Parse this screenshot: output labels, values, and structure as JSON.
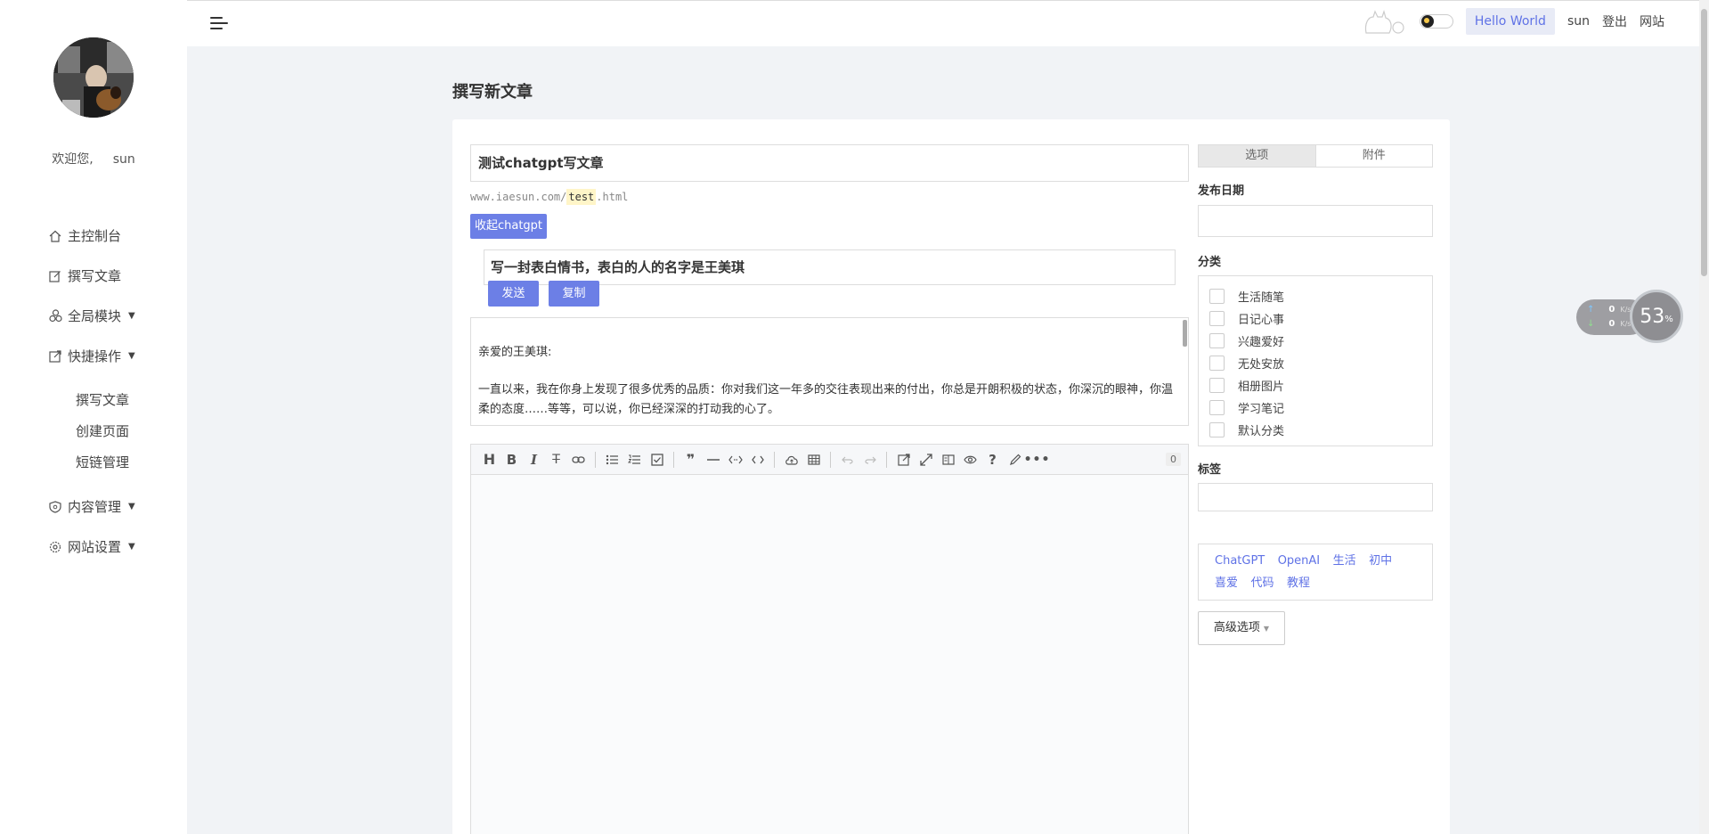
{
  "sidebar": {
    "welcome_prefix": "欢迎您,",
    "username": "sun",
    "items": [
      {
        "label": "主控制台",
        "icon": "home-icon"
      },
      {
        "label": "撰写文章",
        "icon": "edit-icon"
      },
      {
        "label": "全局模块",
        "icon": "modules-icon"
      },
      {
        "label": "快捷操作",
        "icon": "shortcut-icon"
      },
      {
        "label": "内容管理",
        "icon": "content-icon"
      },
      {
        "label": "网站设置",
        "icon": "settings-icon"
      }
    ],
    "subitems": [
      {
        "label": "撰写文章"
      },
      {
        "label": "创建页面"
      },
      {
        "label": "短链管理"
      }
    ]
  },
  "topbar": {
    "hello": "Hello World",
    "user": "sun",
    "logout": "登出",
    "site": "网站"
  },
  "page": {
    "title": "撰写新文章"
  },
  "editor": {
    "post_title": "测试chatgpt写文章",
    "slug_prefix": "www.iaesun.com/",
    "slug": "test",
    "slug_suffix": ".html",
    "collapse_chatgpt": "收起chatgpt",
    "prompt": "写一封表白情书，表白的人的名字是王美琪",
    "send": "发送",
    "copy": "复制",
    "answer_lines": [
      "亲爱的王美琪:",
      "一直以来，我在你身上发现了很多优秀的品质：你对我们这一年多的交往表现出来的付出，你总是开朗积极的状态，你深沉的眼神，你温柔的态度……等等，可以说，你已经深深的打动我的心了。"
    ],
    "word_count": "0"
  },
  "side": {
    "tab_options": "选项",
    "tab_attachments": "附件",
    "publish_date_label": "发布日期",
    "category_label": "分类",
    "categories": [
      "生活随笔",
      "日记心事",
      "兴趣爱好",
      "无处安放",
      "相册图片",
      "学习笔记",
      "默认分类"
    ],
    "tags_label": "标签",
    "tags": [
      "ChatGPT",
      "OpenAI",
      "生活",
      "初中",
      "喜爱",
      "代码",
      "教程"
    ],
    "advanced": "高级选项"
  },
  "network": {
    "up_value": "0",
    "down_value": "0",
    "unit": "K/s",
    "percent": "53",
    "percent_sign": "%"
  },
  "colors": {
    "accent": "#6c7fe6",
    "link": "#5f72e6",
    "background": "#f1f3f6"
  }
}
